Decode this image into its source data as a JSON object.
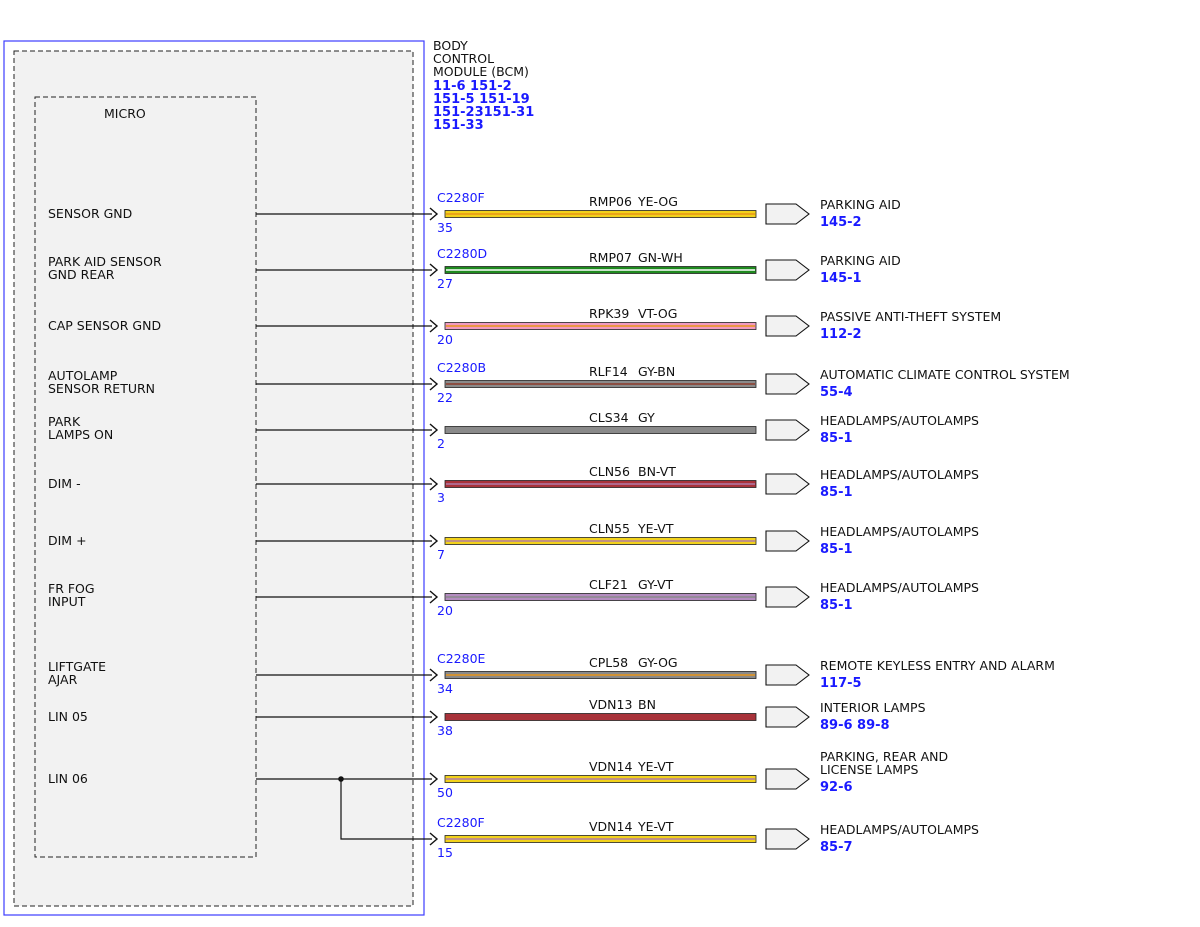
{
  "module": {
    "title_lines": [
      "BODY",
      "CONTROL",
      "MODULE (BCM)"
    ],
    "ref_lines": [
      "11-6  151-2",
      "151-5  151-19",
      "151-23151-31",
      "151-33"
    ],
    "micro_label": "MICRO"
  },
  "pins": [
    {
      "label": [
        "SENSOR GND"
      ],
      "connector": "C2280F",
      "pin": "35",
      "circuit": "RMP06",
      "color_code": "YE-OG",
      "wire": [
        "#f2d21b",
        "#e8951a"
      ],
      "dest": [
        "PARKING AID"
      ],
      "refs": "145-2"
    },
    {
      "label": [
        "PARK AID SENSOR",
        "GND REAR"
      ],
      "connector": "C2280D",
      "pin": "27",
      "circuit": "RMP07",
      "color_code": "GN-WH",
      "wire": [
        "#1f8a1f",
        "#ffffff"
      ],
      "dest": [
        "PARKING AID"
      ],
      "refs": "145-1"
    },
    {
      "label": [
        "CAP SENSOR GND"
      ],
      "connector": "",
      "pin": "20",
      "circuit": "RPK39",
      "color_code": "VT-OG",
      "wire": [
        "#f29ac0",
        "#e8951a"
      ],
      "dest": [
        "PASSIVE ANTI-THEFT SYSTEM"
      ],
      "refs": "112-2"
    },
    {
      "label": [
        "AUTOLAMP",
        "SENSOR RETURN"
      ],
      "connector": "C2280B",
      "pin": "22",
      "circuit": "RLF14",
      "color_code": "GY-BN",
      "wire": [
        "#8a8a8a",
        "#8b3a2a"
      ],
      "dest": [
        "AUTOMATIC CLIMATE CONTROL SYSTEM"
      ],
      "refs": "55-4"
    },
    {
      "label": [
        "PARK",
        "LAMPS ON"
      ],
      "connector": "",
      "pin": "2",
      "circuit": "CLS34",
      "color_code": "GY",
      "wire": [
        "#8a8a8a",
        "#8a8a8a"
      ],
      "dest": [
        "HEADLAMPS/AUTOLAMPS"
      ],
      "refs": "85-1"
    },
    {
      "label": [
        "DIM -"
      ],
      "connector": "",
      "pin": "3",
      "circuit": "CLN56",
      "color_code": "BN-VT",
      "wire": [
        "#a8323a",
        "#b07aa8"
      ],
      "dest": [
        "HEADLAMPS/AUTOLAMPS"
      ],
      "refs": "85-1"
    },
    {
      "label": [
        "DIM +"
      ],
      "connector": "",
      "pin": "7",
      "circuit": "CLN55",
      "color_code": "YE-VT",
      "wire": [
        "#f2d21b",
        "#b07aa8"
      ],
      "dest": [
        "HEADLAMPS/AUTOLAMPS"
      ],
      "refs": "85-1"
    },
    {
      "label": [
        "FR FOG",
        "INPUT"
      ],
      "connector": "",
      "pin": "20",
      "circuit": "CLF21",
      "color_code": "GY-VT",
      "wire": [
        "#b48cc0",
        "#8a8a8a"
      ],
      "dest": [
        "HEADLAMPS/AUTOLAMPS"
      ],
      "refs": "85-1"
    },
    {
      "label": [
        "LIFTGATE",
        "AJAR"
      ],
      "connector": "C2280E",
      "pin": "34",
      "circuit": "CPL58",
      "color_code": "GY-OG",
      "wire": [
        "#8a8a8a",
        "#e8951a"
      ],
      "dest": [
        "REMOTE KEYLESS ENTRY AND ALARM"
      ],
      "refs": "117-5"
    },
    {
      "label": [
        "LIN 05"
      ],
      "connector": "",
      "pin": "38",
      "circuit": "VDN13",
      "color_code": "BN",
      "wire": [
        "#a8323a",
        "#a8323a"
      ],
      "dest": [
        "INTERIOR LAMPS"
      ],
      "refs": "89-6     89-8"
    },
    {
      "label": [
        "LIN 06"
      ],
      "connector": "",
      "pin": "50",
      "circuit": "VDN14",
      "color_code": "YE-VT",
      "wire": [
        "#f2d21b",
        "#b07aa8"
      ],
      "dest": [
        "PARKING, REAR AND",
        "LICENSE LAMPS"
      ],
      "refs": "92-6"
    },
    {
      "label": [],
      "connector": "C2280F",
      "pin": "15",
      "circuit": "VDN14",
      "color_code": "YE-VT",
      "wire": [
        "#f2d21b",
        "#b07aa8"
      ],
      "dest": [
        "HEADLAMPS/AUTOLAMPS"
      ],
      "refs": "85-7"
    }
  ]
}
